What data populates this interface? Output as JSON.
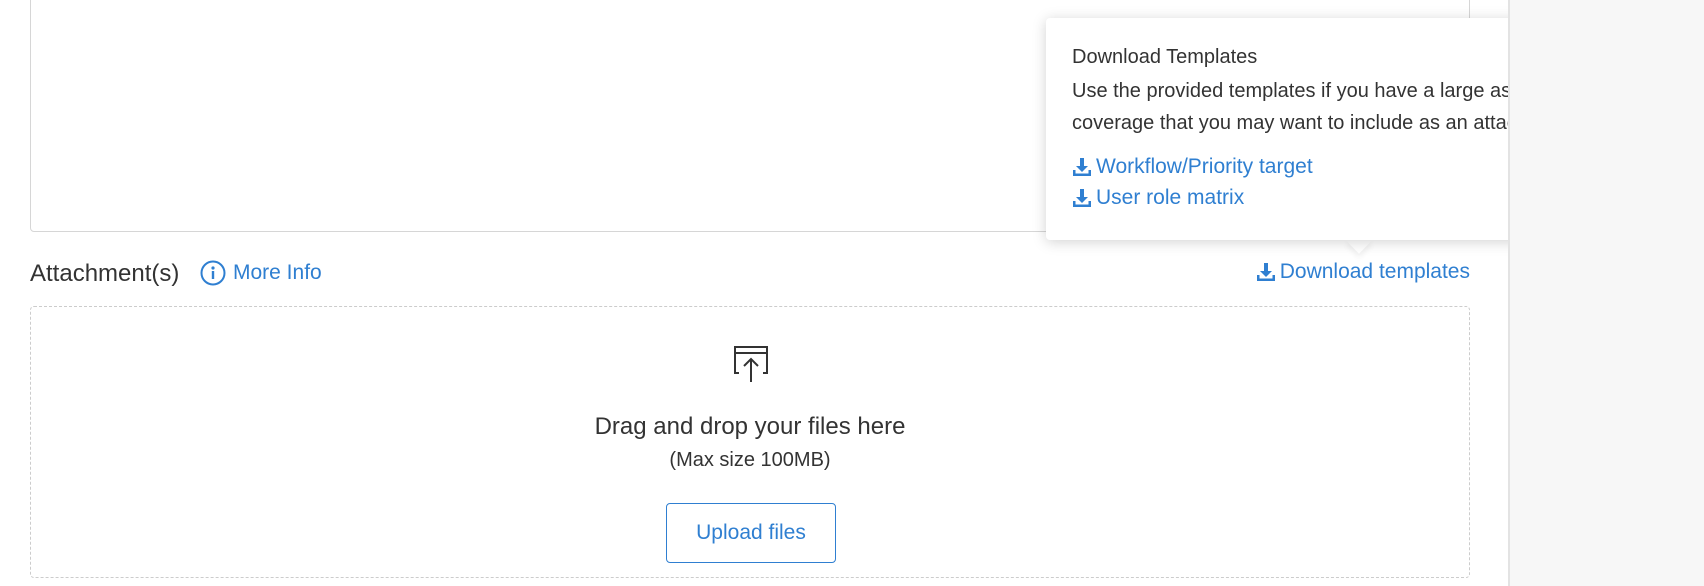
{
  "attachments": {
    "title": "Attachment(s)",
    "more_info_label": "More Info",
    "download_templates_label": "Download templates"
  },
  "dropzone": {
    "main_text": "Drag and drop your files here",
    "sub_text": "(Max size 100MB)",
    "upload_button_label": "Upload files"
  },
  "popover": {
    "title": "Download Templates",
    "description": "Use the provided templates if you have a large asset size or test coverage that you may want to include as an attachment.",
    "links": [
      {
        "label": "Workflow/Priority target",
        "icon": "download-icon"
      },
      {
        "label": "User role matrix",
        "icon": "download-icon"
      }
    ]
  },
  "colors": {
    "link": "#2f7fd1",
    "text": "#333333",
    "border": "#d6d6d6",
    "panel": "#f7f7f7"
  }
}
